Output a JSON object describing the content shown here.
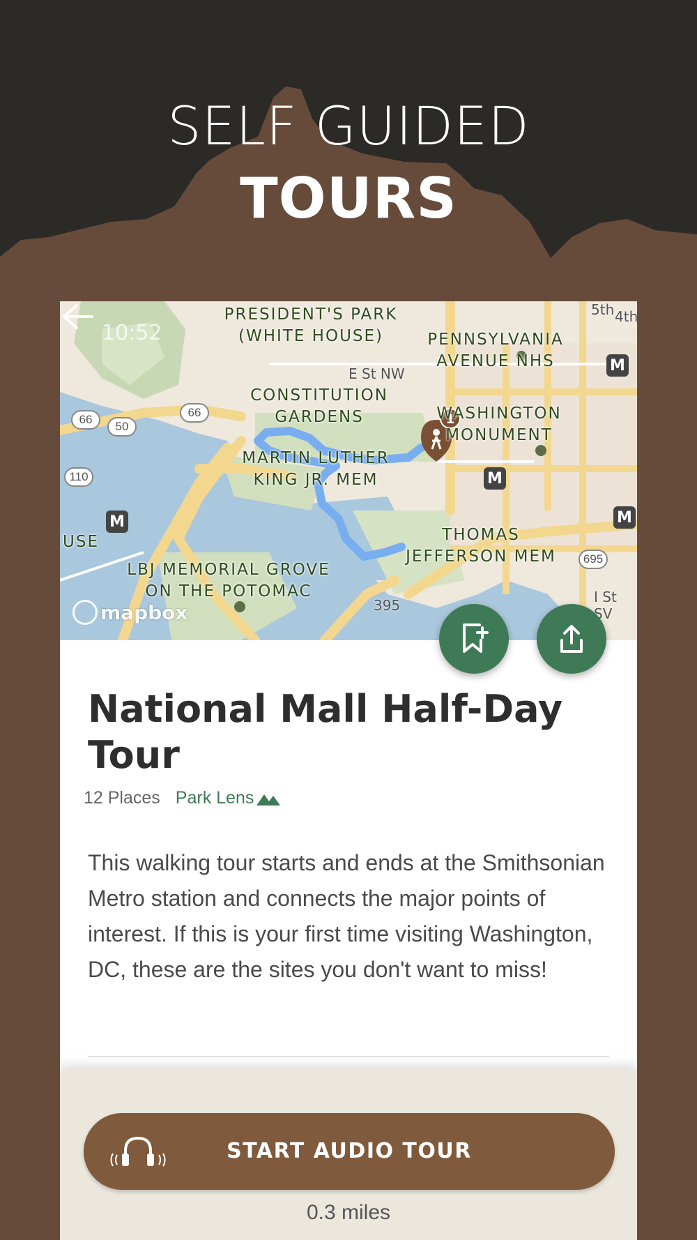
{
  "hero": {
    "line1": "SELF GUIDED",
    "line2": "TOURS"
  },
  "status_bar": {
    "time": "10:52"
  },
  "map": {
    "labels": {
      "presidents_park": "PRESIDENT'S PARK\n(WHITE HOUSE)",
      "pennsylvania": "PENNSYLVANIA\nAVENUE NHS",
      "constitution": "CONSTITUTION\nGARDENS",
      "washington": "WASHINGTON\nMONUMENT",
      "mlk": "MARTIN LUTHER\nKING JR. MEM",
      "jefferson": "THOMAS\nJEFFERSON MEM",
      "lbj": "LBJ MEMORIAL GROVE\nON THE POTOMAC",
      "use": "USE"
    },
    "streets": {
      "e_st": "E St NW",
      "i395": "395",
      "i_st": "I St SV",
      "fifth": "5th",
      "fourth": "4th"
    },
    "shields": [
      "66",
      "50",
      "66",
      "110",
      "695"
    ],
    "metro_letter": "M",
    "marker_number": "1",
    "attribution": "mapbox",
    "route_color": "#78aef0"
  },
  "actions": {
    "bookmark_icon": "bookmark-add-icon",
    "share_icon": "share-icon"
  },
  "tour": {
    "title": "National Mall Half-Day Tour",
    "places": "12 Places",
    "park_lens": "Park Lens",
    "description": "This walking tour starts and ends at the Smithsonian Metro station and connects the major points of interest. If this is your first time visiting Washington, DC, these are the sites you don't want to miss!"
  },
  "bottom": {
    "start_label": "START AUDIO TOUR",
    "distance": "0.3 miles"
  },
  "colors": {
    "brown_bg": "#664a3a",
    "dark_top": "#2b2a27",
    "accent_green": "#3f7a56",
    "button_brown": "#805a3c"
  }
}
